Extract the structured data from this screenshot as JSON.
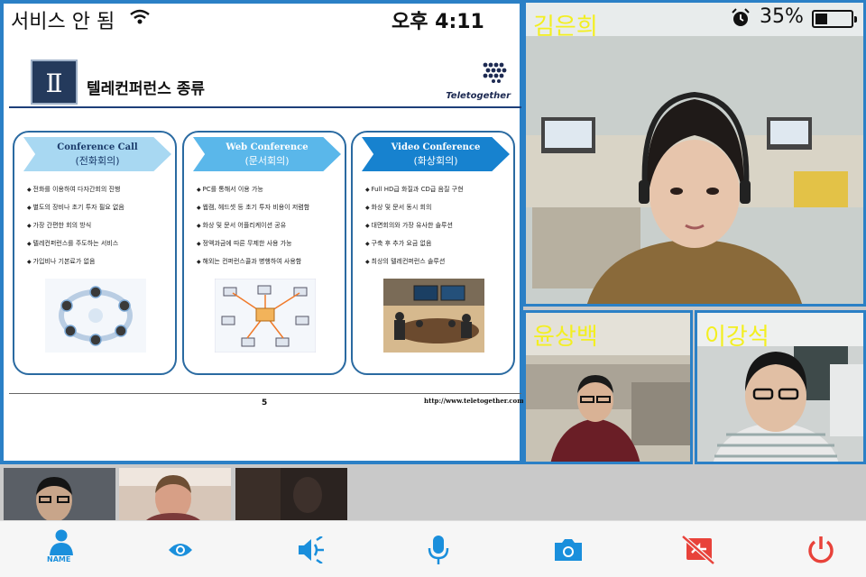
{
  "status_bar": {
    "carrier": "서비스 안 됨",
    "time": "오후 4:11",
    "battery_percent": "35%",
    "battery_level": 0.35
  },
  "slide": {
    "roman_numeral": "Ⅱ",
    "title": "텔레컨퍼런스 종류",
    "logo_text": "Teletogether",
    "page_number": "5",
    "url": "http://www.teletogether.com",
    "cards": [
      {
        "title": "Conference Call",
        "subtitle": "(전화회의)",
        "color": "#a8d8f2",
        "text_color": "#1a3a6a",
        "items": [
          "전화를 이용하여 다자간회의 진행",
          "별도의 장비나 초기 투자 필요 없음",
          "가장 간편한 회의 방식",
          "텔레컨퍼런스를 주도하는 서비스",
          "가입비나 기본료가 없음"
        ]
      },
      {
        "title": "Web Conference",
        "subtitle": "(문서회의)",
        "color": "#5ab7ea",
        "text_color": "#ffffff",
        "items": [
          "PC를 통해서 이용 가능",
          "웹캠, 헤드셋 등 초기 투자 비용이 저렴함",
          "화상 및 문서 어플리케이션 공유",
          "정액과금에 따른 무제한 사용 가능",
          "해외는 컨퍼런스콜과 병행하여 사용함"
        ]
      },
      {
        "title": "Video Conference",
        "subtitle": "(화상회의)",
        "color": "#1782cf",
        "text_color": "#ffffff",
        "items": [
          "Full HD급 화질과 CD급 음질 구현",
          "화상 및 문서 동시 회의",
          "대면회의와 가장 유사한 솔루션",
          "구축 후 추가 요금 없음",
          "최상의 텔레컨퍼런스 솔루션"
        ]
      }
    ]
  },
  "videos": {
    "large_name": "김은희",
    "small1_name": "윤상백",
    "small2_name": "이강석"
  },
  "toolbar": {
    "name_label": "NAME",
    "accent_color": "#1a8fdc",
    "danger_color": "#e8423a"
  }
}
